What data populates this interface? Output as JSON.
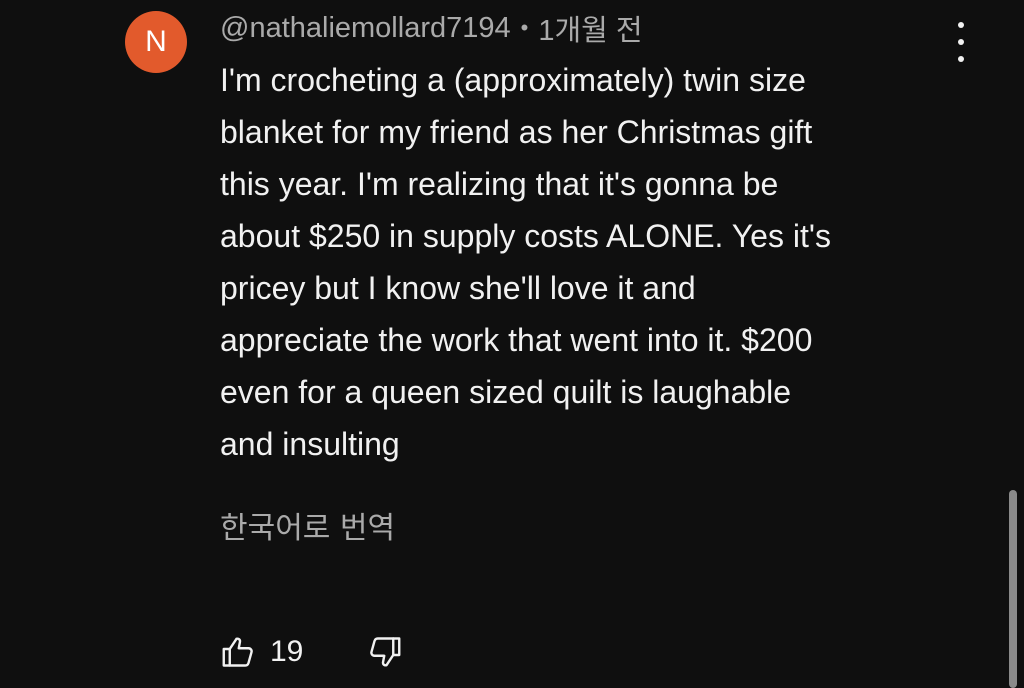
{
  "comment": {
    "avatar_letter": "N",
    "avatar_color": "#e25a2c",
    "author": "@nathaliemollard7194",
    "separator": "•",
    "timestamp": "1개월 전",
    "text": "I'm crocheting a (approximately) twin size\nblanket for my friend as her Christmas gift\nthis year. I'm realizing that it's gonna be\nabout $250 in supply costs ALONE. Yes it's\npricey but I know she'll love it and\nappreciate the work that went into it. $200\neven for a queen sized quilt is laughable\nand insulting",
    "translate_label": "한국어로 번역",
    "like_count": "19",
    "icons": {
      "more": "more-vert-icon",
      "like": "thumbs-up-icon",
      "dislike": "thumbs-down-icon"
    }
  },
  "colors": {
    "background": "#0f0f0f",
    "text_primary": "#f1f1f1",
    "text_secondary": "#aaaaaa"
  }
}
